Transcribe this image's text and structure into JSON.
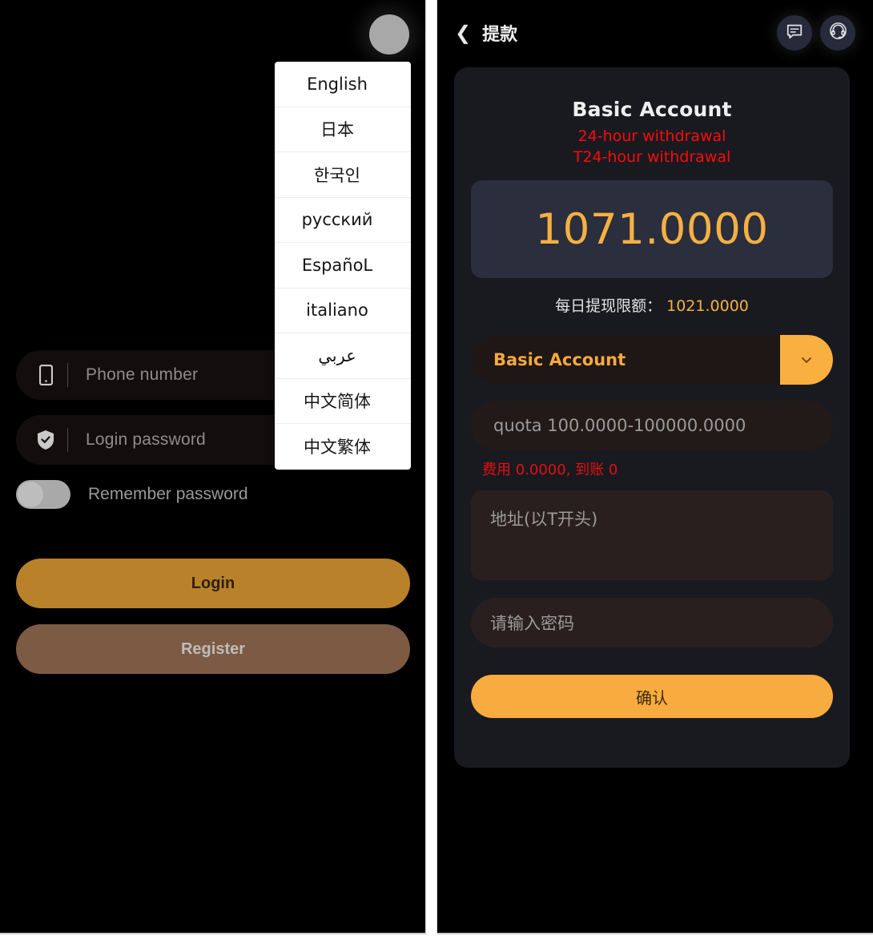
{
  "login": {
    "avatar_name": "user-avatar",
    "language_menu": {
      "items": [
        {
          "label": "English"
        },
        {
          "label": "日本"
        },
        {
          "label": "한국인"
        },
        {
          "label": "русский"
        },
        {
          "label": "EspañoL"
        },
        {
          "label": "italiano"
        },
        {
          "label": "عربي"
        },
        {
          "label": "中文简体"
        },
        {
          "label": "中文繁体"
        }
      ]
    },
    "phone_placeholder": "Phone number",
    "password_placeholder": "Login password",
    "remember_label": "Remember password",
    "login_button": "Login",
    "register_button": "Register"
  },
  "withdraw": {
    "title": "提款",
    "back_icon": "❮",
    "account_title": "Basic Account",
    "warning_line1": "24-hour withdrawal",
    "warning_line2": "T24-hour withdrawal",
    "balance": "1071.0000",
    "daily_limit_label": "每日提现限额：",
    "daily_limit_value": "1021.0000",
    "account_select_value": "Basic Account",
    "amount_placeholder": "quota 100.0000-100000.0000",
    "fee_note": "费用 0.0000, 到账 0",
    "address_placeholder": "地址(以T开头)",
    "password_placeholder": "请输入密码",
    "confirm_button": "确认"
  },
  "colors": {
    "accent_orange": "#f8ab3e",
    "amount_orange": "#f6b042",
    "warning_red": "#fb0b0b",
    "login_gold": "#b9812a",
    "register_brown": "#7d5a43",
    "balance_box": "#2a2e3d",
    "card_bg": "#191a20"
  }
}
